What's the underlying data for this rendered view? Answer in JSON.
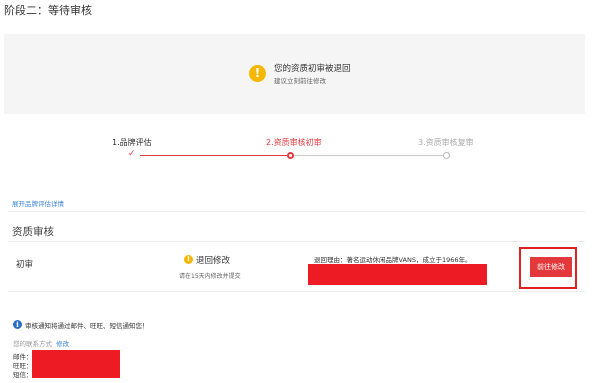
{
  "page": {
    "title": "阶段二：等待审核"
  },
  "notice": {
    "icon": "warning-icon",
    "icon_glyph": "!",
    "title": "您的资质初审被退回",
    "subtitle": "建议立刻前往修改"
  },
  "steps": [
    {
      "label": "1.品牌评估",
      "state": "done"
    },
    {
      "label": "2.资质审核初审",
      "state": "active"
    },
    {
      "label": "3.资质审核复审",
      "state": "pending"
    }
  ],
  "step_marks": {
    "done_mark": "✓"
  },
  "expand_link": "展开品牌评估详情",
  "section": {
    "title": "资质审核",
    "row": {
      "label": "初审",
      "status_icon": "!",
      "status": "退回修改",
      "status_hint": "请在15天内修改并提交",
      "reason": "退回理由：著名运动休闲品牌VANS，成立于1966年。",
      "button": "前往修改"
    }
  },
  "notification": {
    "icon_glyph": "i",
    "text": "审核通知将通过邮件、旺旺、短信通知您！",
    "contact_label": "您的联系方式",
    "contact_edit": "修改",
    "email_label": "邮件：",
    "wangwang_label": "旺旺：",
    "sms_label": "短信："
  },
  "colors": {
    "accent": "#e4393c",
    "redaction": "#ed1c24",
    "warning": "#f5b800",
    "info": "#2a70c8",
    "link": "#3a85d6",
    "inactive": "#cccccc"
  }
}
